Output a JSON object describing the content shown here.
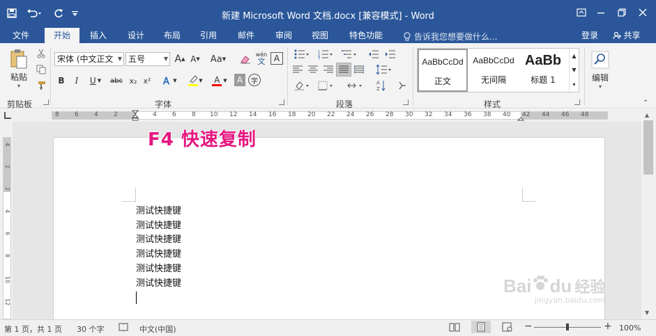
{
  "window": {
    "title": "新建 Microsoft Word 文档.docx [兼容模式] - Word",
    "accent": "#2b579a",
    "qat": [
      "save-icon",
      "undo-icon",
      "redo-icon",
      "customize-qat-icon"
    ],
    "controls": [
      "ribbon-display-icon",
      "minimize-icon",
      "restore-icon",
      "close-icon"
    ]
  },
  "tabs": [
    "文件",
    "开始",
    "插入",
    "设计",
    "布局",
    "引用",
    "邮件",
    "审阅",
    "视图",
    "特色功能"
  ],
  "active_tab": "开始",
  "tell_me": "告诉我您想要做什么...",
  "account": {
    "login": "登录",
    "share": "共享"
  },
  "ribbon": {
    "clipboard": {
      "label": "剪贴板",
      "paste": "粘贴"
    },
    "font": {
      "label": "字体",
      "font_name": "宋体 (中文正文",
      "font_size": "五号",
      "grow": "A",
      "shrink": "A",
      "case": "Aa",
      "bold": "B",
      "italic": "I",
      "underline": "U",
      "strike": "abc",
      "subscript": "x₂",
      "superscript": "x²",
      "font_color_letter": "A",
      "shade_letter": "A",
      "border_letter": "A",
      "phonetic": "wén",
      "enclose": "字",
      "highlight_color": "#ffff00",
      "font_color": "#ff0000"
    },
    "paragraph": {
      "label": "段落"
    },
    "styles": {
      "label": "样式",
      "items": [
        {
          "preview": "AaBbCcDd",
          "name": "正文"
        },
        {
          "preview": "AaBbCcDd",
          "name": "无间隔"
        },
        {
          "preview": "AaBb",
          "name": "标题 1"
        }
      ]
    },
    "editing": {
      "label": "编辑"
    }
  },
  "ruler": {
    "ticks": [
      "8",
      "6",
      "4",
      "2",
      "2",
      "4",
      "6",
      "8",
      "10",
      "12",
      "14",
      "16",
      "18",
      "20",
      "22",
      "24",
      "26",
      "28",
      "30",
      "32",
      "34",
      "36",
      "38",
      "40",
      "42",
      "44",
      "46",
      "48"
    ],
    "vticks": [
      "4",
      "2",
      "2",
      "4",
      "6",
      "8",
      "10",
      "12"
    ]
  },
  "overlay": "F4 快速复制",
  "document": {
    "lines": [
      "测试快捷键",
      "测试快捷键",
      "测试快捷键",
      "测试快捷键",
      "测试快捷键",
      "测试快捷键"
    ]
  },
  "status": {
    "page": "第 1 页，共 1 页",
    "words": "30 个字",
    "language": "中文(中国)",
    "zoom": "100%",
    "zoom_level_percent": 100
  },
  "watermark": {
    "brand": "Bai",
    "brand2": "du",
    "suffix": "经验",
    "url": "jingyan.baidu.com"
  }
}
